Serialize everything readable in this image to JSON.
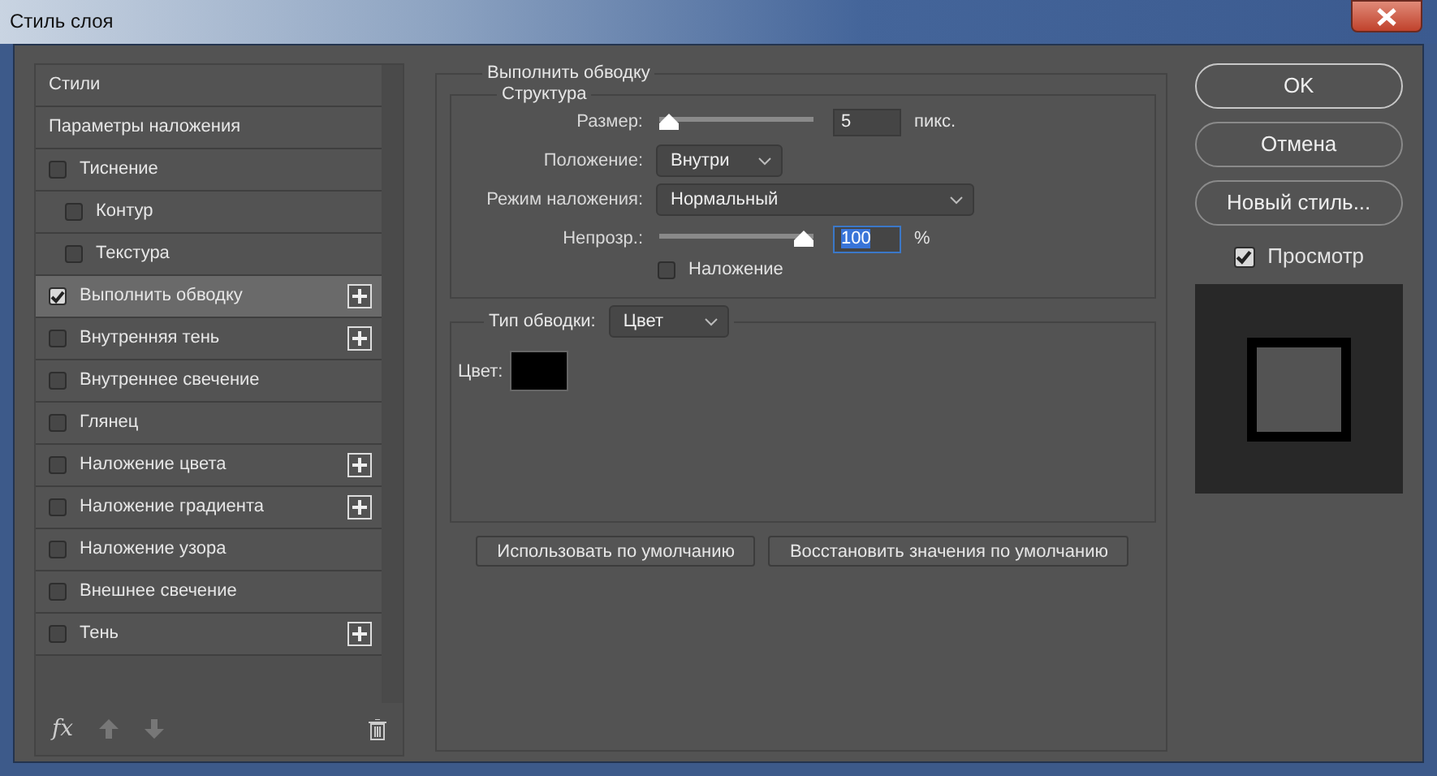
{
  "window": {
    "title": "Стиль слоя"
  },
  "styles": [
    {
      "label": "Стили",
      "kind": "header",
      "selected": false
    },
    {
      "label": "Параметры наложения",
      "kind": "header",
      "selected": false
    },
    {
      "label": "Тиснение",
      "kind": "checkbox",
      "checked": false,
      "selected": false,
      "add": false,
      "children": [
        {
          "label": "Контур",
          "kind": "checkbox",
          "checked": false,
          "selected": false,
          "add": false
        },
        {
          "label": "Текстура",
          "kind": "checkbox",
          "checked": false,
          "selected": false,
          "add": false
        }
      ]
    },
    {
      "label": "Выполнить обводку",
      "kind": "checkbox",
      "checked": true,
      "selected": true,
      "add": true
    },
    {
      "label": "Внутренняя тень",
      "kind": "checkbox",
      "checked": false,
      "selected": false,
      "add": true
    },
    {
      "label": "Внутреннее свечение",
      "kind": "checkbox",
      "checked": false,
      "selected": false,
      "add": false
    },
    {
      "label": "Глянец",
      "kind": "checkbox",
      "checked": false,
      "selected": false,
      "add": false
    },
    {
      "label": "Наложение цвета",
      "kind": "checkbox",
      "checked": false,
      "selected": false,
      "add": true
    },
    {
      "label": "Наложение градиента",
      "kind": "checkbox",
      "checked": false,
      "selected": false,
      "add": true
    },
    {
      "label": "Наложение узора",
      "kind": "checkbox",
      "checked": false,
      "selected": false,
      "add": false
    },
    {
      "label": "Внешнее свечение",
      "kind": "checkbox",
      "checked": false,
      "selected": false,
      "add": false
    },
    {
      "label": "Тень",
      "kind": "checkbox",
      "checked": false,
      "selected": false,
      "add": true
    }
  ],
  "styles_toolbar": {
    "fx": "fx"
  },
  "stroke": {
    "title": "Выполнить обводку",
    "structure": {
      "title": "Структура",
      "size": {
        "label": "Размер:",
        "level": 0,
        "value": "5",
        "unit": "пикс."
      },
      "position": {
        "label": "Положение:",
        "value": "Внутри"
      },
      "blend_mode": {
        "label": "Режим наложения:",
        "value": "Нормальный"
      },
      "opacity": {
        "label": "Непрозр.:",
        "level": 1,
        "value": "100",
        "unit": "%",
        "value_selected": true
      },
      "overprint": {
        "label": "Наложение",
        "checked": false
      }
    },
    "fill_type": {
      "label": "Тип обводки:",
      "value": "Цвет",
      "color_label": "Цвет:",
      "color": "#000000"
    },
    "buttons": [
      "Использовать по умолчанию",
      "Восстановить значения по умолчанию"
    ]
  },
  "actions": [
    {
      "label": "OK",
      "default": true
    },
    {
      "label": "Отмена",
      "default": false
    },
    {
      "label": "Новый стиль...",
      "default": false
    }
  ],
  "preview": {
    "label": "Просмотр",
    "checked": true
  }
}
